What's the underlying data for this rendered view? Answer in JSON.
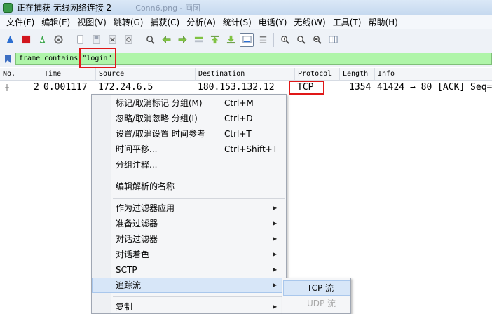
{
  "window": {
    "title": "正在捕获 无线网络连接 2",
    "ghost_text": "Conn6.png - 画图"
  },
  "menubar": [
    "文件(F)",
    "编辑(E)",
    "视图(V)",
    "跳转(G)",
    "捕获(C)",
    "分析(A)",
    "统计(S)",
    "电话(Y)",
    "无线(W)",
    "工具(T)",
    "帮助(H)"
  ],
  "toolbar": {
    "icons": [
      "start-capture-icon",
      "stop-capture-icon",
      "restart-capture-icon",
      "capture-options-icon",
      "open-file-icon",
      "save-file-icon",
      "close-file-icon",
      "reload-icon",
      "find-packet-icon",
      "go-back-icon",
      "go-forward-icon",
      "go-to-packet-icon",
      "first-packet-icon",
      "last-packet-icon",
      "autoscroll-icon",
      "colorize-icon",
      "zoom-in-icon",
      "zoom-out-icon",
      "normal-size-icon",
      "resize-columns-icon"
    ]
  },
  "filter": {
    "value": "frame contains \"login\""
  },
  "columns": [
    "No.",
    "Time",
    "Source",
    "Destination",
    "Protocol",
    "Length",
    "Info"
  ],
  "packets": [
    {
      "no": "2",
      "time": "0.001117",
      "source": "172.24.6.5",
      "destination": "180.153.132.12",
      "protocol": "TCP",
      "length": "1354",
      "info": "41424 → 80 [ACK] Seq="
    }
  ],
  "context_menu": {
    "items": [
      {
        "label": "标记/取消标记 分组(M)",
        "shortcut": "Ctrl+M"
      },
      {
        "label": "忽略/取消忽略 分组(I)",
        "shortcut": "Ctrl+D"
      },
      {
        "label": "设置/取消设置 时间参考",
        "shortcut": "Ctrl+T"
      },
      {
        "label": "时间平移...",
        "shortcut": "Ctrl+Shift+T"
      },
      {
        "label": "分组注释...",
        "shortcut": ""
      },
      {
        "label": "编辑解析的名称",
        "shortcut": ""
      },
      {
        "label": "作为过滤器应用",
        "shortcut": ""
      },
      {
        "label": "准备过滤器",
        "shortcut": ""
      },
      {
        "label": "对话过滤器",
        "shortcut": ""
      },
      {
        "label": "对话着色",
        "shortcut": ""
      },
      {
        "label": "SCTP",
        "shortcut": ""
      },
      {
        "label": "追踪流",
        "shortcut": ""
      },
      {
        "label": "复制",
        "shortcut": ""
      }
    ],
    "submenu": [
      {
        "label": "TCP 流",
        "enabled": true
      },
      {
        "label": "UDP 流",
        "enabled": false
      }
    ]
  },
  "colors": {
    "filter_valid_bg": "#aff5a9",
    "highlight_border": "#e01818",
    "menu_hover": "#d7e6f8"
  }
}
